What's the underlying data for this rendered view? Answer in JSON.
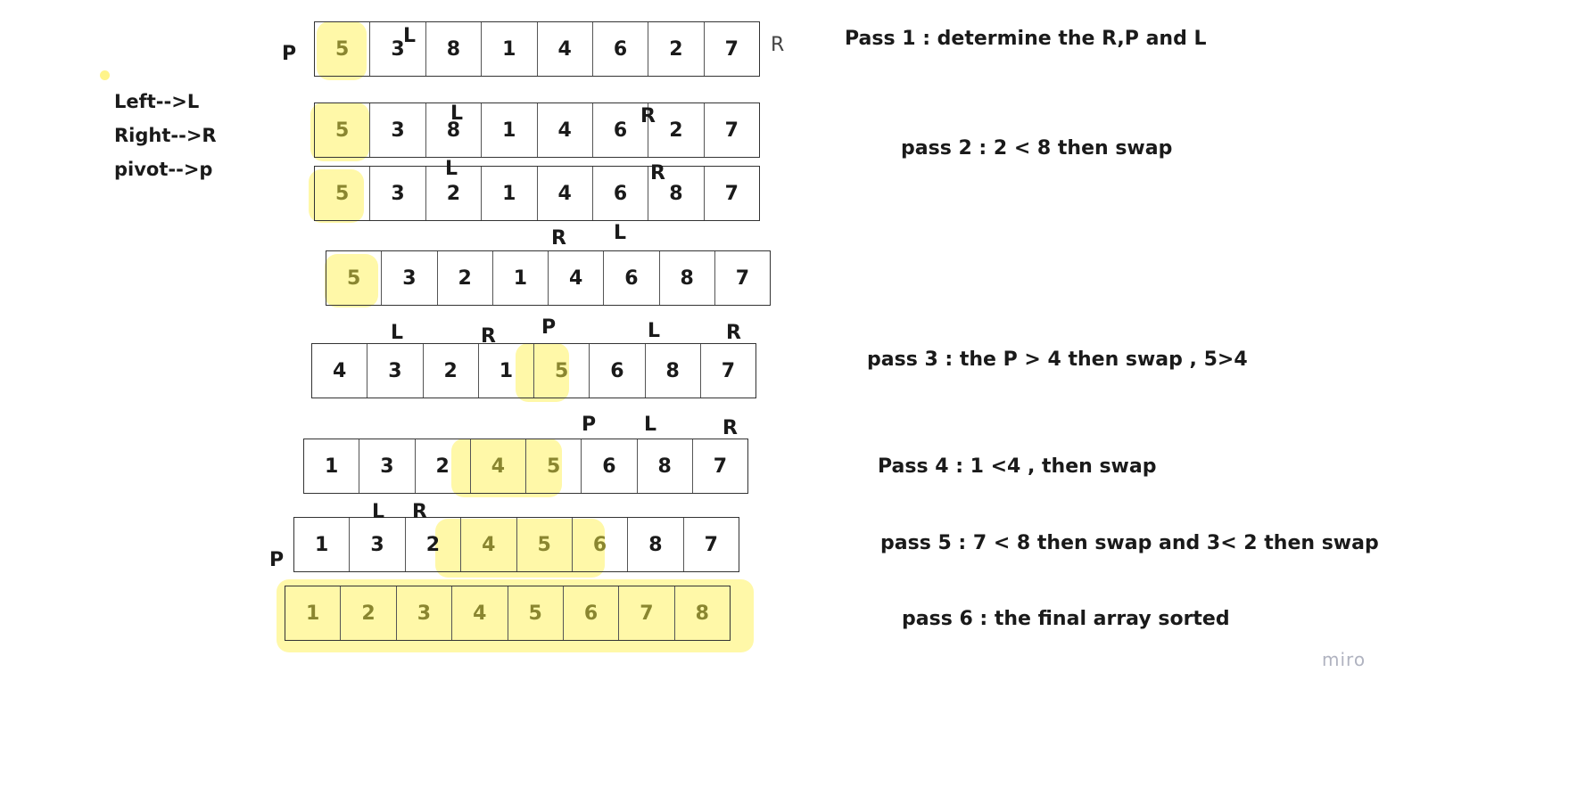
{
  "legend": [
    "Left-->L",
    "Right-->R",
    "pivot-->p"
  ],
  "highlight_color": "#fff36e",
  "rows": [
    {
      "values": [
        "5",
        "3",
        "8",
        "1",
        "4",
        "6",
        "2",
        "7"
      ],
      "highlighted": [
        0
      ]
    },
    {
      "values": [
        "5",
        "3",
        "8",
        "1",
        "4",
        "6",
        "2",
        "7"
      ],
      "highlighted": [
        0
      ]
    },
    {
      "values": [
        "5",
        "3",
        "2",
        "1",
        "4",
        "6",
        "8",
        "7"
      ],
      "highlighted": [
        0
      ]
    },
    {
      "values": [
        "5",
        "3",
        "2",
        "1",
        "4",
        "6",
        "8",
        "7"
      ],
      "highlighted": [
        0
      ]
    },
    {
      "values": [
        "4",
        "3",
        "2",
        "1",
        "5",
        "6",
        "8",
        "7"
      ],
      "highlighted": [
        4
      ]
    },
    {
      "values": [
        "1",
        "3",
        "2",
        "4",
        "5",
        "6",
        "8",
        "7"
      ],
      "highlighted": [
        3,
        4
      ]
    },
    {
      "values": [
        "1",
        "3",
        "2",
        "4",
        "5",
        "6",
        "8",
        "7"
      ],
      "highlighted": [
        3,
        4,
        5
      ]
    },
    {
      "values": [
        "1",
        "2",
        "3",
        "4",
        "5",
        "6",
        "7",
        "8"
      ],
      "highlighted": [
        0,
        1,
        2,
        3,
        4,
        5,
        6,
        7
      ]
    }
  ],
  "markers": [
    "P",
    "L",
    "R",
    "L",
    "R",
    "L",
    "R",
    "R",
    "L",
    "L",
    "R",
    "P",
    "L",
    "R",
    "P",
    "L",
    "R",
    "L",
    "R",
    "P"
  ],
  "notes": [
    "Pass 1 : determine the R,P and L",
    "pass 2 : 2 < 8 then swap",
    "pass 3 : the P > 4 then swap , 5>4",
    "Pass 4 : 1 <4 , then swap",
    "pass 5 :  7 < 8  then swap and  3< 2 then swap",
    "pass 6 : the final array sorted"
  ],
  "logo": "miro"
}
